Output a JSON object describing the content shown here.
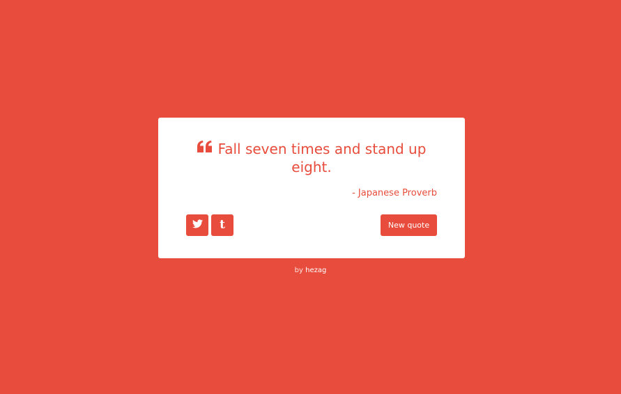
{
  "page": {
    "background_color": "#e74c3c"
  },
  "quote": {
    "icon": "quote-left-icon",
    "text": "Fall seven times and stand up eight.",
    "author": "- Japanese Proverb"
  },
  "actions": {
    "twitter_icon": "twitter-icon",
    "tumblr_icon": "tumblr-icon",
    "new_quote_label": "New quote"
  },
  "footer": {
    "by_label": "by",
    "author_link": "hezag"
  },
  "colors": {
    "accent": "#e74c3c",
    "card": "#ffffff"
  }
}
